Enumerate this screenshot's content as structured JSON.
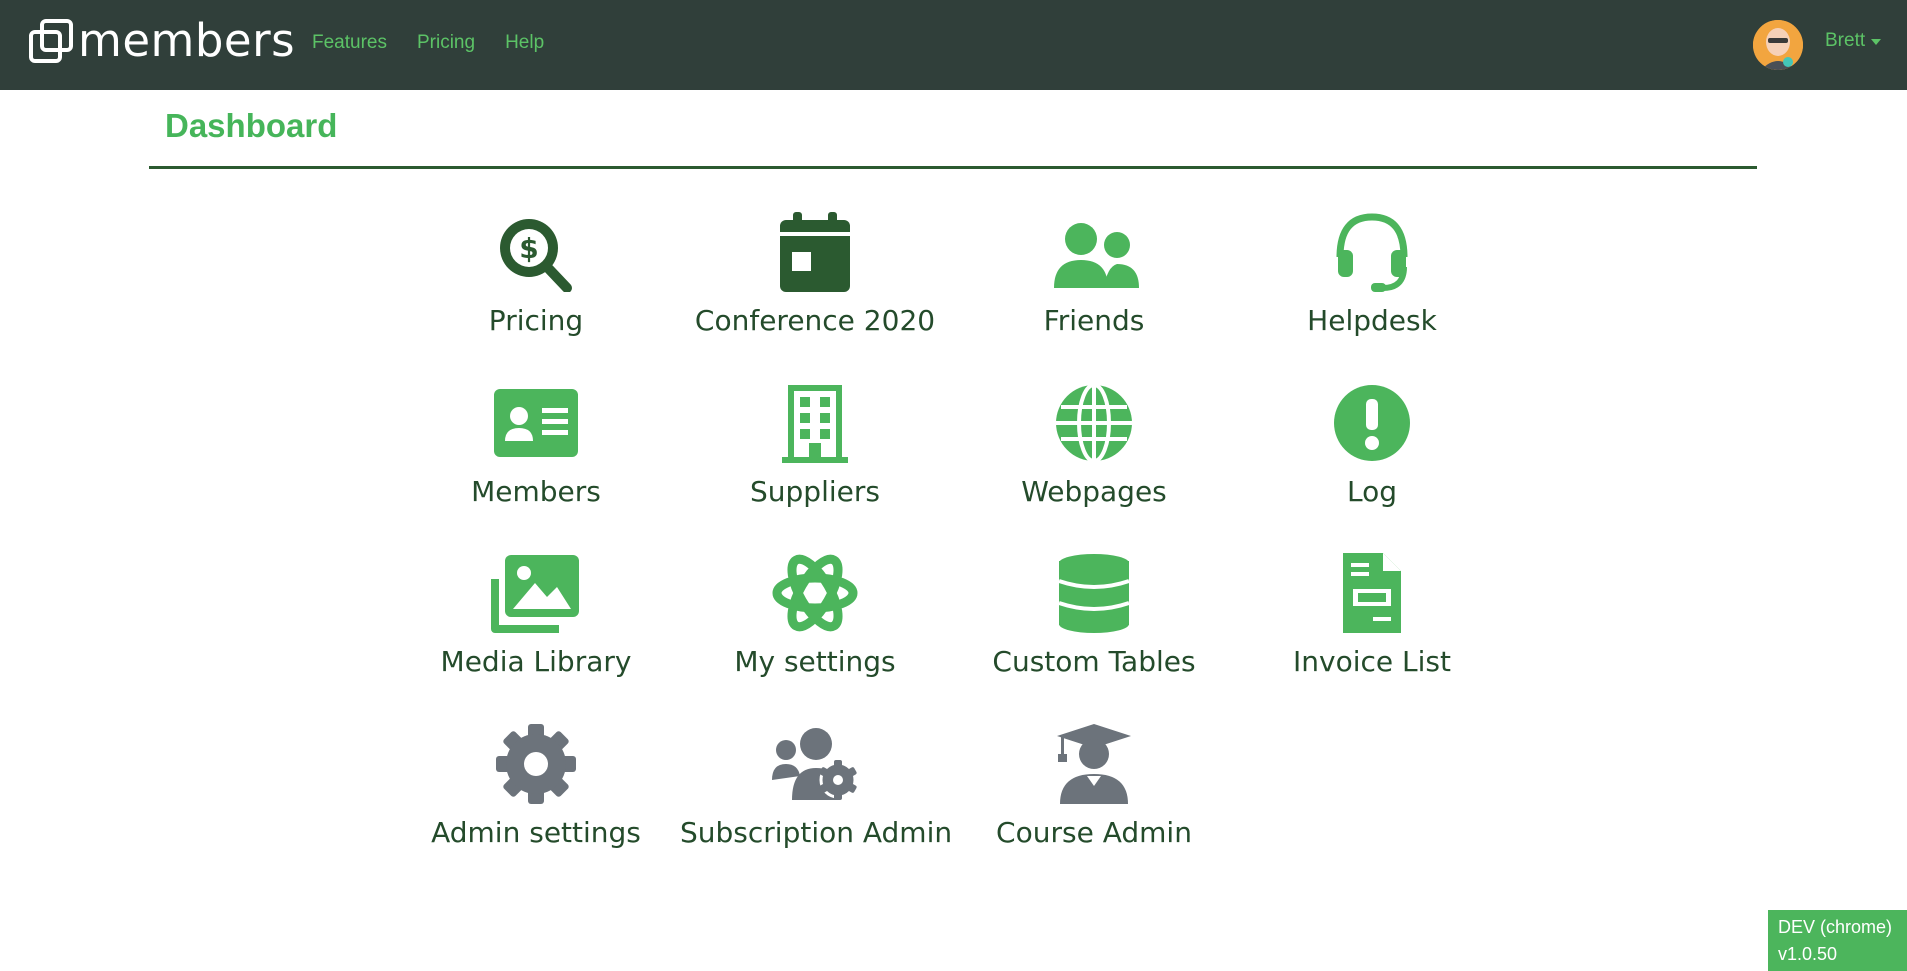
{
  "header": {
    "brand": "members",
    "nav": [
      "Features",
      "Pricing",
      "Help"
    ],
    "user": "Brett"
  },
  "page": {
    "title": "Dashboard"
  },
  "tiles": [
    {
      "label": "Pricing",
      "icon": "search-dollar-icon"
    },
    {
      "label": "Conference 2020",
      "icon": "calendar-icon"
    },
    {
      "label": "Friends",
      "icon": "user-friends-icon"
    },
    {
      "label": "Helpdesk",
      "icon": "headset-icon"
    },
    {
      "label": "Members",
      "icon": "id-card-icon"
    },
    {
      "label": "Suppliers",
      "icon": "building-icon"
    },
    {
      "label": "Webpages",
      "icon": "globe-icon"
    },
    {
      "label": "Log",
      "icon": "exclamation-circle-icon"
    },
    {
      "label": "Media Library",
      "icon": "images-icon"
    },
    {
      "label": "My settings",
      "icon": "atom-icon"
    },
    {
      "label": "Custom Tables",
      "icon": "database-icon"
    },
    {
      "label": "Invoice List",
      "icon": "file-invoice-icon"
    },
    {
      "label": "Admin settings",
      "icon": "cog-icon"
    },
    {
      "label": "Subscription Admin",
      "icon": "users-cog-icon"
    },
    {
      "label": "Course Admin",
      "icon": "user-graduate-icon"
    }
  ],
  "footer": {
    "env": "DEV (chrome)",
    "version": "v1.0.50"
  },
  "colors": {
    "navbar": "#303f3a",
    "link": "#5cc366",
    "icon_dark": "#2b5a30",
    "icon_green": "#4cb55c",
    "icon_gray": "#6c737b",
    "label": "#244b2b"
  }
}
